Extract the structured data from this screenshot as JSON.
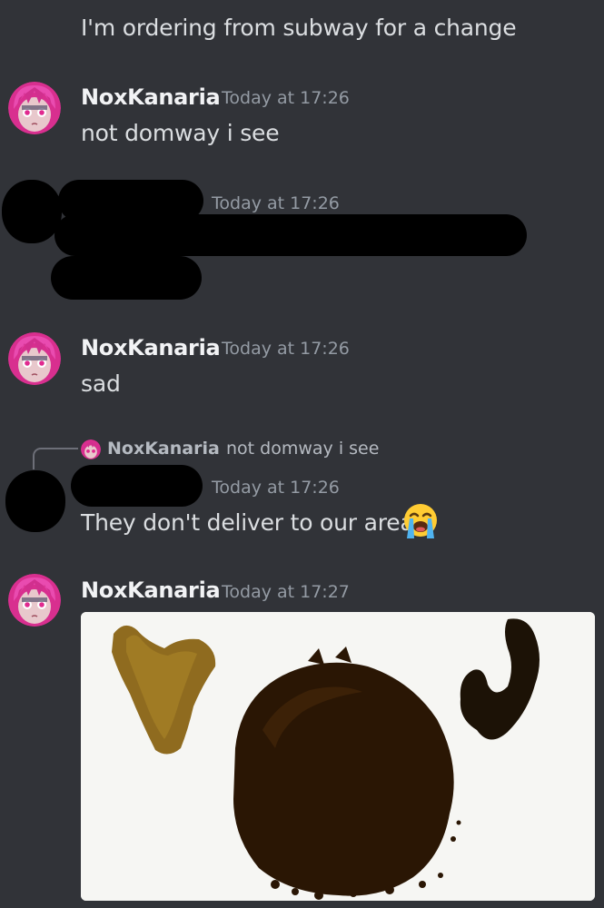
{
  "messages": [
    {
      "text": "I'm ordering from subway for a change"
    },
    {
      "author": "NoxKanaria",
      "time": "Today at 17:26",
      "text": "not domway i see"
    },
    {
      "author": "",
      "time": "Today at 17:26",
      "text": ""
    },
    {
      "author": "NoxKanaria",
      "time": "Today at 17:26",
      "text": "sad"
    },
    {
      "reply": {
        "author": "NoxKanaria",
        "text": "not domway i see"
      },
      "author": "",
      "time": "Today at 17:26",
      "text": "They don't deliver to our area",
      "emoji": "loudly-crying-face-icon"
    },
    {
      "author": "NoxKanaria",
      "time": "Today at 17:27",
      "text": ""
    }
  ],
  "colors": {
    "background": "#313338",
    "text": "#dbdee1",
    "username": "#f2f3f5",
    "timestamp": "#949ba4",
    "avatar_accent": "#e0309e"
  }
}
